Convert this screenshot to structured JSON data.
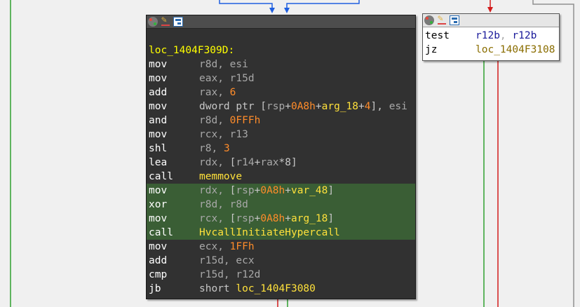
{
  "colors": {
    "background": "#f0f0f0",
    "node_dark_bg": "#313131",
    "highlight_bg": "#3a5e35",
    "edge_blue": "#1f5fe0",
    "edge_red": "#d21b1b",
    "edge_green": "#2fa02f",
    "edge_gray": "#8f8f8f"
  },
  "main_node": {
    "label": "loc_1404F309D:",
    "instructions": [
      {
        "mnemonic": "mov",
        "operands": [
          {
            "t": "reg",
            "v": "r8d"
          },
          {
            "t": "sep",
            "v": ", "
          },
          {
            "t": "reg",
            "v": "esi"
          }
        ]
      },
      {
        "mnemonic": "mov",
        "operands": [
          {
            "t": "reg",
            "v": "eax"
          },
          {
            "t": "sep",
            "v": ", "
          },
          {
            "t": "reg",
            "v": "r15d"
          }
        ]
      },
      {
        "mnemonic": "add",
        "operands": [
          {
            "t": "reg",
            "v": "rax"
          },
          {
            "t": "sep",
            "v": ", "
          },
          {
            "t": "num",
            "v": "6"
          }
        ]
      },
      {
        "mnemonic": "mov",
        "operands": [
          {
            "t": "plain",
            "v": "dword ptr ["
          },
          {
            "t": "reg",
            "v": "rsp"
          },
          {
            "t": "plain",
            "v": "+"
          },
          {
            "t": "num",
            "v": "0A8h"
          },
          {
            "t": "plain",
            "v": "+"
          },
          {
            "t": "sym",
            "v": "arg_18"
          },
          {
            "t": "plain",
            "v": "+"
          },
          {
            "t": "num",
            "v": "4"
          },
          {
            "t": "plain",
            "v": "], "
          },
          {
            "t": "reg",
            "v": "esi"
          }
        ]
      },
      {
        "mnemonic": "and",
        "operands": [
          {
            "t": "reg",
            "v": "r8d"
          },
          {
            "t": "sep",
            "v": ", "
          },
          {
            "t": "num",
            "v": "0FFFh"
          }
        ]
      },
      {
        "mnemonic": "mov",
        "operands": [
          {
            "t": "reg",
            "v": "rcx"
          },
          {
            "t": "sep",
            "v": ", "
          },
          {
            "t": "reg",
            "v": "r13"
          }
        ]
      },
      {
        "mnemonic": "shl",
        "operands": [
          {
            "t": "reg",
            "v": "r8"
          },
          {
            "t": "sep",
            "v": ", "
          },
          {
            "t": "num",
            "v": "3"
          }
        ]
      },
      {
        "mnemonic": "lea",
        "operands": [
          {
            "t": "reg",
            "v": "rdx"
          },
          {
            "t": "sep",
            "v": ", "
          },
          {
            "t": "plain",
            "v": "["
          },
          {
            "t": "reg",
            "v": "r14"
          },
          {
            "t": "plain",
            "v": "+"
          },
          {
            "t": "reg",
            "v": "rax"
          },
          {
            "t": "plain",
            "v": "*8]"
          }
        ]
      },
      {
        "mnemonic": "call",
        "operands": [
          {
            "t": "sym",
            "v": "memmove"
          }
        ]
      },
      {
        "mnemonic": "mov",
        "highlight": true,
        "operands": [
          {
            "t": "reg",
            "v": "rdx"
          },
          {
            "t": "sep",
            "v": ", "
          },
          {
            "t": "plain",
            "v": "["
          },
          {
            "t": "reg",
            "v": "rsp"
          },
          {
            "t": "plain",
            "v": "+"
          },
          {
            "t": "num",
            "v": "0A8h"
          },
          {
            "t": "plain",
            "v": "+"
          },
          {
            "t": "sym",
            "v": "var_48"
          },
          {
            "t": "plain",
            "v": "]"
          }
        ]
      },
      {
        "mnemonic": "xor",
        "highlight": true,
        "operands": [
          {
            "t": "reg",
            "v": "r8d"
          },
          {
            "t": "sep",
            "v": ", "
          },
          {
            "t": "reg",
            "v": "r8d"
          }
        ]
      },
      {
        "mnemonic": "mov",
        "highlight": true,
        "operands": [
          {
            "t": "reg",
            "v": "rcx"
          },
          {
            "t": "sep",
            "v": ", "
          },
          {
            "t": "plain",
            "v": "["
          },
          {
            "t": "reg",
            "v": "rsp"
          },
          {
            "t": "plain",
            "v": "+"
          },
          {
            "t": "num",
            "v": "0A8h"
          },
          {
            "t": "plain",
            "v": "+"
          },
          {
            "t": "sym",
            "v": "arg_18"
          },
          {
            "t": "plain",
            "v": "]"
          }
        ]
      },
      {
        "mnemonic": "call",
        "highlight": true,
        "operands": [
          {
            "t": "sym",
            "v": "HvcallInitiateHypercall"
          }
        ]
      },
      {
        "mnemonic": "mov",
        "operands": [
          {
            "t": "reg",
            "v": "ecx"
          },
          {
            "t": "sep",
            "v": ", "
          },
          {
            "t": "num",
            "v": "1FFh"
          }
        ]
      },
      {
        "mnemonic": "add",
        "operands": [
          {
            "t": "reg",
            "v": "r15d"
          },
          {
            "t": "sep",
            "v": ", "
          },
          {
            "t": "reg",
            "v": "ecx"
          }
        ]
      },
      {
        "mnemonic": "cmp",
        "operands": [
          {
            "t": "reg",
            "v": "r15d"
          },
          {
            "t": "sep",
            "v": ", "
          },
          {
            "t": "reg",
            "v": "r12d"
          }
        ]
      },
      {
        "mnemonic": "jb",
        "operands": [
          {
            "t": "plain",
            "v": "short "
          },
          {
            "t": "sym",
            "v": "loc_1404F3080"
          }
        ]
      }
    ]
  },
  "side_node": {
    "instructions": [
      {
        "mnemonic": "test",
        "operands": [
          {
            "t": "reg",
            "v": "r12b"
          },
          {
            "t": "sep",
            "v": ", "
          },
          {
            "t": "reg",
            "v": "r12b"
          }
        ]
      },
      {
        "mnemonic": "jz",
        "operands": [
          {
            "t": "sym",
            "v": "loc_1404F3108"
          }
        ]
      }
    ]
  },
  "titlebar_icons": [
    "graph-overview-icon",
    "edit-color-icon",
    "node-group-icon"
  ]
}
